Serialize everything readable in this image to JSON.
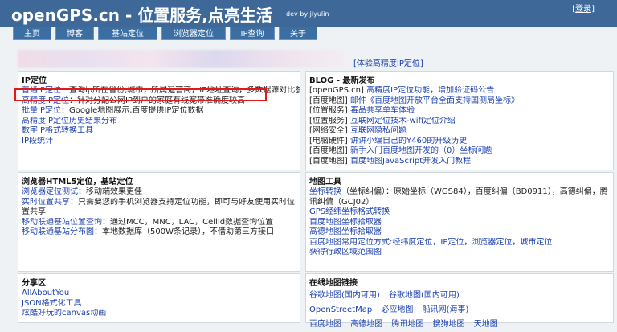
{
  "header": {
    "logo": "openGPS.cn - 位置服务,点亮生活",
    "byline": "dev by jiyulin",
    "login_bracket_open": "[",
    "login": "登录",
    "login_bracket_close": "]"
  },
  "nav": [
    "主页",
    "博客",
    "基站定位",
    "浏览器定位",
    "IP查询",
    "关于"
  ],
  "banner": {
    "link": "[体验高精度IP定位]"
  },
  "ip_panel": {
    "title": "IP定位",
    "rows": [
      {
        "link": "普通IP定位",
        "text": "：查询ip所在省份,城市，所属运营商，IP地址查询，多数据源对比参考"
      },
      {
        "link": "高精度IP定位",
        "text": "：针对分配公网IP到户的家庭有线宽带准确度较高"
      },
      {
        "link": "批量IP定位",
        "text": "：Google地图展示,百度提供IP定位数据"
      },
      {
        "link": "高精度IP定位历史结果分布",
        "text": ""
      },
      {
        "link": "数字IP格式转换工具",
        "text": ""
      },
      {
        "link": "IP段统计",
        "text": ""
      }
    ]
  },
  "blog_panel": {
    "title": "BLOG - 最新发布",
    "rows": [
      {
        "tag": "[openGPS.cn]",
        "link": "高精度IP定位功能，增加验证码公告"
      },
      {
        "tag": "[百度地图]",
        "link": "邮件《百度地图开放平台全面支持国测局坐标》"
      },
      {
        "tag": "[位置服务]",
        "link": "毒品共享单车体验"
      },
      {
        "tag": "[位置服务]",
        "link": "互联网定位技术-wifi定位介绍"
      },
      {
        "tag": "[网络安全]",
        "link": "互联网隐私问题"
      },
      {
        "tag": "[电脑硬件]",
        "link": "讲讲小编自己的Y460的升级历史"
      },
      {
        "tag": "[百度地图]",
        "link": "新手入门百度地图开发的（0）坐标问题"
      },
      {
        "tag": "[百度地图]",
        "link": "百度地图JavaScript开发入门教程"
      }
    ]
  },
  "html5_panel": {
    "title": "浏览器HTML5定位，基站定位",
    "rows": [
      {
        "link": "浏览器定位测试",
        "text": "：移动端效果更佳"
      },
      {
        "link": "实时位置共享",
        "text": "：只需要您的手机浏览器支持定位功能，即可与好友使用实时位置共享"
      },
      {
        "link": "移动联通基站位置查询",
        "text": "：通过MCC，MNC，LAC，CellId数据查询位置"
      },
      {
        "link": "移动联通基站分布图",
        "text": "：本地数据库（500W条记录），不借助第三方接口"
      }
    ]
  },
  "map_tools_panel": {
    "title": "地图工具",
    "rows": [
      {
        "link": "坐标转换",
        "text": "（坐标纠偏）：原始坐标（WGS84），百度纠偏（BD0911），高德纠偏，腾讯纠偏（GCJ02）"
      },
      {
        "link": "GPS经纬坐标格式转换",
        "text": ""
      },
      {
        "link": "百度地图坐标拾取器",
        "text": ""
      },
      {
        "link": "高德地图坐标拾取器",
        "text": ""
      },
      {
        "link": "百度地图常用定位方式:经纬度定位，IP定位，浏览器定位，城市定位",
        "text": ""
      },
      {
        "link": "获得行政区域范围图",
        "text": ""
      }
    ]
  },
  "share_panel": {
    "title": "分享区",
    "rows": [
      "AllAboutYou",
      "JSON格式化工具",
      "炫酷好玩的canvas动画"
    ]
  },
  "online_maps_panel": {
    "title": "在线地图链接",
    "row1": [
      "谷歌地图(国内可用)",
      "谷歌地图(国内可用)"
    ],
    "row2": [
      "OpenStreetMap",
      "必应地图",
      "船讯网(海事)"
    ],
    "row3": [
      "百度地图",
      "高德地图",
      "腾讯地图",
      "搜狗地图",
      "天地图"
    ]
  },
  "colors": {
    "header_bg": "#3d6898",
    "nav_bg": "#3b6fa3",
    "link": "#1a3fae",
    "highlight": "#e01a1a"
  }
}
